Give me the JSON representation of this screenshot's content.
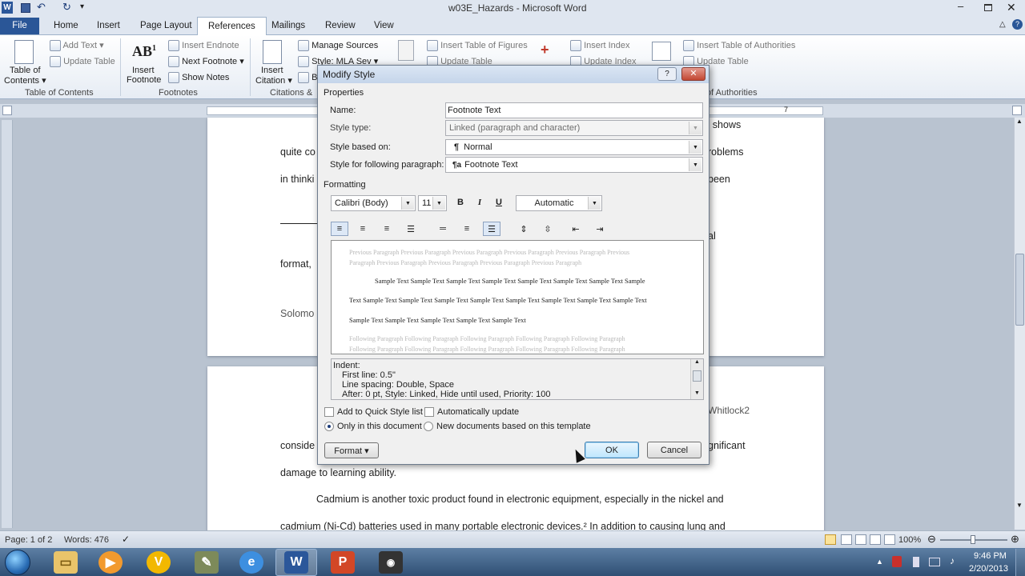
{
  "window": {
    "title": "w03E_Hazards - Microsoft Word"
  },
  "qat": {
    "customize": "▾"
  },
  "tabs": [
    "File",
    "Home",
    "Insert",
    "Page Layout",
    "References",
    "Mailings",
    "Review",
    "View"
  ],
  "ribbon": {
    "toc": {
      "label1": "Table of",
      "label2": "Contents ▾",
      "add_text": "Add Text ▾",
      "update_table": "Update Table",
      "group": "Table of Contents"
    },
    "footnotes": {
      "insert1": "Insert",
      "insert2": "Footnote",
      "insert_endnote": "Insert Endnote",
      "next_footnote": "Next Footnote ▾",
      "show_notes": "Show Notes",
      "group": "Footnotes",
      "ab_icon": "AB",
      "ab_sup": "1"
    },
    "citations": {
      "insert1": "Insert",
      "insert2": "Citation ▾",
      "manage_sources": "Manage Sources",
      "style": "Style: MLA Sev ▾",
      "bib": "B",
      "group": "Citations &"
    },
    "captions": {
      "insert_tof": "Insert Table of Figures",
      "update_table": "Update Table"
    },
    "index": {
      "insert_index": "Insert Index",
      "update_index": "Update Index"
    },
    "toa": {
      "insert_toa": "Insert Table of Authorities",
      "update_table": "Update Table",
      "group": "of Authorities"
    }
  },
  "ruler": {
    "mark": "7"
  },
  "document": {
    "page1_lines": [
      "quite co",
      "in thinki",
      "format,",
      "Solomo"
    ],
    "page1_right": [
      "’ shows",
      "roblems",
      "been",
      "al"
    ],
    "page2_right_top": "Whitlock2",
    "page2_left": "conside",
    "page2_right": "gnificant",
    "page2_lines": [
      "damage to learning ability.",
      "Cadmium is another toxic product found in electronic equipment, especially in the nickel and",
      "cadmium (Ni-Cd) batteries used in many portable electronic devices.² In addition to causing lung and"
    ]
  },
  "dialog": {
    "title": "Modify Style",
    "help": "?",
    "properties_label": "Properties",
    "name_label": "Name:",
    "name_value": "Footnote Text",
    "style_type_label": "Style type:",
    "style_type_value": "Linked (paragraph and character)",
    "based_on_label": "Style based on:",
    "based_on_value": "Normal",
    "following_label": "Style for following paragraph:",
    "following_value": "Footnote Text",
    "formatting_label": "Formatting",
    "font": "Calibri (Body)",
    "size": "11",
    "bold": "B",
    "italic": "I",
    "underline": "U",
    "color": "Automatic",
    "preview": {
      "prev1": "Previous Paragraph Previous Paragraph Previous Paragraph Previous Paragraph Previous Paragraph Previous",
      "prev2": "Paragraph Previous Paragraph Previous Paragraph Previous Paragraph Previous Paragraph",
      "sample1": "Sample Text Sample Text Sample Text Sample Text Sample Text Sample Text Sample Text Sample",
      "sample2": "Text Sample Text Sample Text Sample Text Sample Text Sample Text Sample Text Sample Text Sample Text",
      "sample3": "Sample Text Sample Text Sample Text Sample Text Sample Text",
      "follow1": "Following Paragraph Following Paragraph Following Paragraph Following Paragraph Following Paragraph",
      "follow2": "Following Paragraph Following Paragraph Following Paragraph Following Paragraph Following Paragraph"
    },
    "description": [
      "Indent:",
      "First line:  0.5\"",
      "Line spacing:  Double, Space",
      "After:  0 pt, Style: Linked, Hide until used, Priority: 100"
    ],
    "add_quick": "Add to Quick Style list",
    "auto_update": "Automatically update",
    "only_doc": "Only in this document",
    "new_docs": "New documents based on this template",
    "format_btn": "Format ▾",
    "ok": "OK",
    "cancel": "Cancel"
  },
  "status": {
    "page": "Page: 1 of 2",
    "words": "Words: 476",
    "zoom": "100%"
  },
  "taskbar": {
    "time": "9:46 PM",
    "date": "2/20/2013"
  }
}
